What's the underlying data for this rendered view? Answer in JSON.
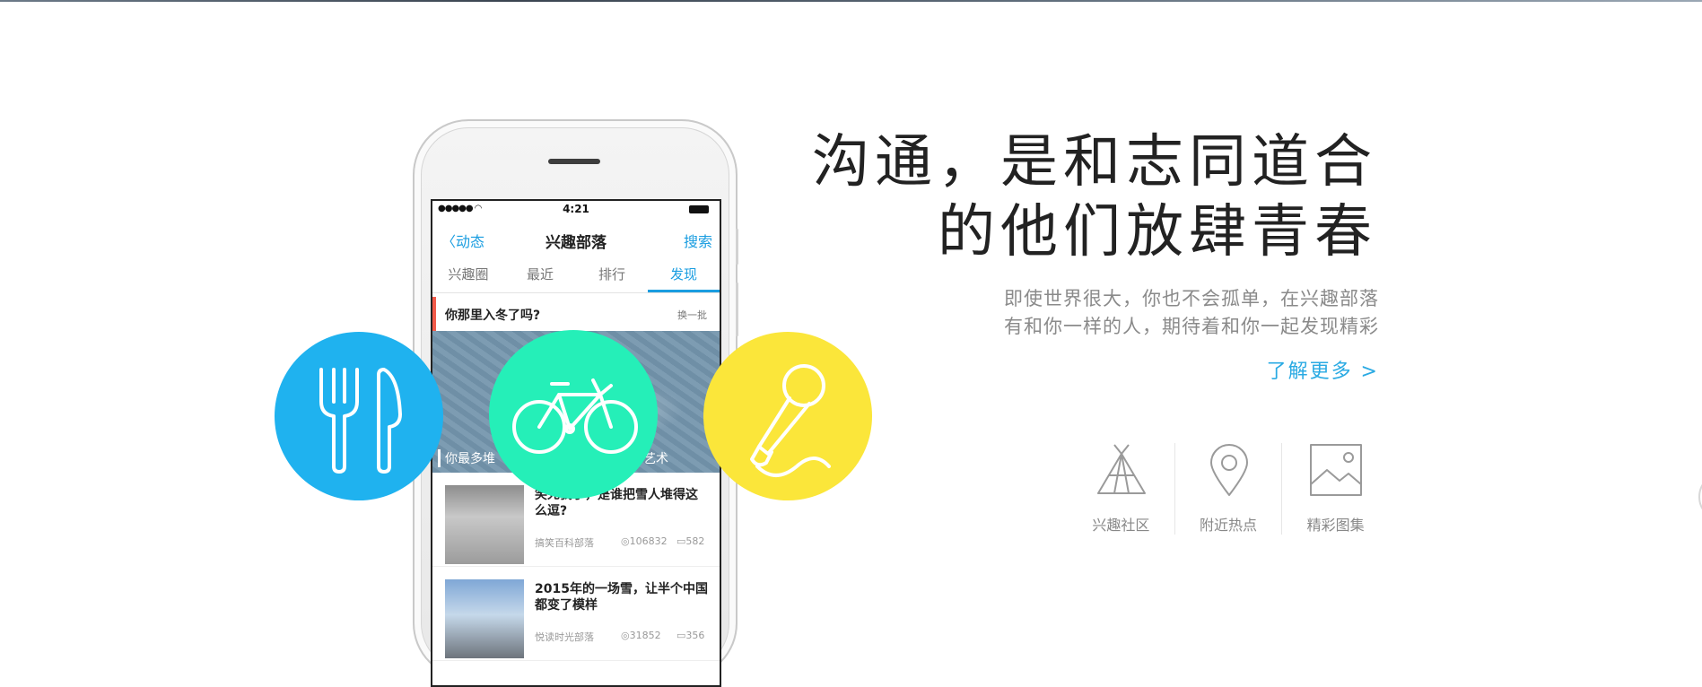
{
  "phone": {
    "status_time": "4:21",
    "nav": {
      "back": "动态",
      "title": "兴趣部落",
      "search": "搜索"
    },
    "tabs": [
      "兴趣圈",
      "最近",
      "排行",
      "发现"
    ],
    "active_tab": "发现",
    "topic": {
      "question": "你那里入冬了吗?",
      "refresh": "换一批"
    },
    "banner": {
      "caption_left": "你最多堆",
      "caption_right": "艺术"
    },
    "articles": [
      {
        "title": "笑死我了，是谁把雪人堆得这么逗?",
        "source": "搞笑百科部落",
        "views": "106832",
        "comments": "582"
      },
      {
        "title": "2015年的一场雪，让半个中国都变了模样",
        "source": "悦读时光部落",
        "views": "31852",
        "comments": "356"
      }
    ]
  },
  "circles": [
    {
      "icon": "fork-knife-icon",
      "color": "#1fb2ef"
    },
    {
      "icon": "bicycle-icon",
      "color": "#25efb8"
    },
    {
      "icon": "microphone-icon",
      "color": "#fbe63a"
    }
  ],
  "headline": {
    "line1": "沟通，是和志同道合",
    "line2": "的他们放肆青春"
  },
  "subcopy": {
    "line1": "即使世界很大，你也不会孤单，在兴趣部落",
    "line2": "有和你一样的人，期待着和你一起发现精彩"
  },
  "more_link": "了解更多 >",
  "features": [
    {
      "icon": "tent-icon",
      "label": "兴趣社区"
    },
    {
      "icon": "location-pin-icon",
      "label": "附近热点"
    },
    {
      "icon": "image-gallery-icon",
      "label": "精彩图集"
    }
  ],
  "colors": {
    "accent": "#1a9de0",
    "link": "#2aaae3",
    "topic_marker": "#f15a4a"
  }
}
